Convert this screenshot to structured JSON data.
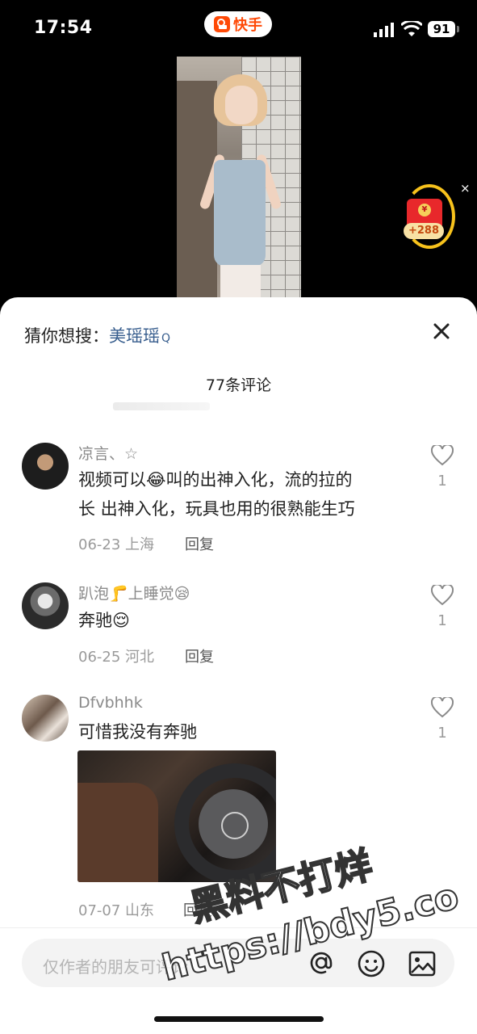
{
  "status_bar": {
    "time": "17:54",
    "app_badge": "快手",
    "battery": "91"
  },
  "red_packet": {
    "reward": "+288",
    "coin_symbol": "¥",
    "close_symbol": "×"
  },
  "suggest": {
    "label": "猜你想搜：",
    "keyword": "美瑶瑶",
    "search_symbol": "Q"
  },
  "comments_header": {
    "count_label": "77条评论"
  },
  "comments": [
    {
      "username": "凉言、☆",
      "text_line1": "视频可以😂叫的出神入化，流的拉的",
      "text_line2": "长  出神入化，玩具也用的很熟能生巧",
      "date_location": "06-23 上海",
      "reply_label": "回复",
      "likes": "1"
    },
    {
      "username": "趴泡🦵上睡觉😪",
      "text": "奔驰😌",
      "date_location": "06-25 河北",
      "reply_label": "回复",
      "likes": "1"
    },
    {
      "username": "Dfvbhhk",
      "text": "可惜我没有奔驰",
      "date_location": "07-07 山东",
      "reply_label": "回复",
      "likes": "1"
    }
  ],
  "input": {
    "placeholder": "仅作者的朋友可评论"
  },
  "watermark": {
    "line1": "黑料不打烊",
    "line2": "https://bdy5.co"
  }
}
